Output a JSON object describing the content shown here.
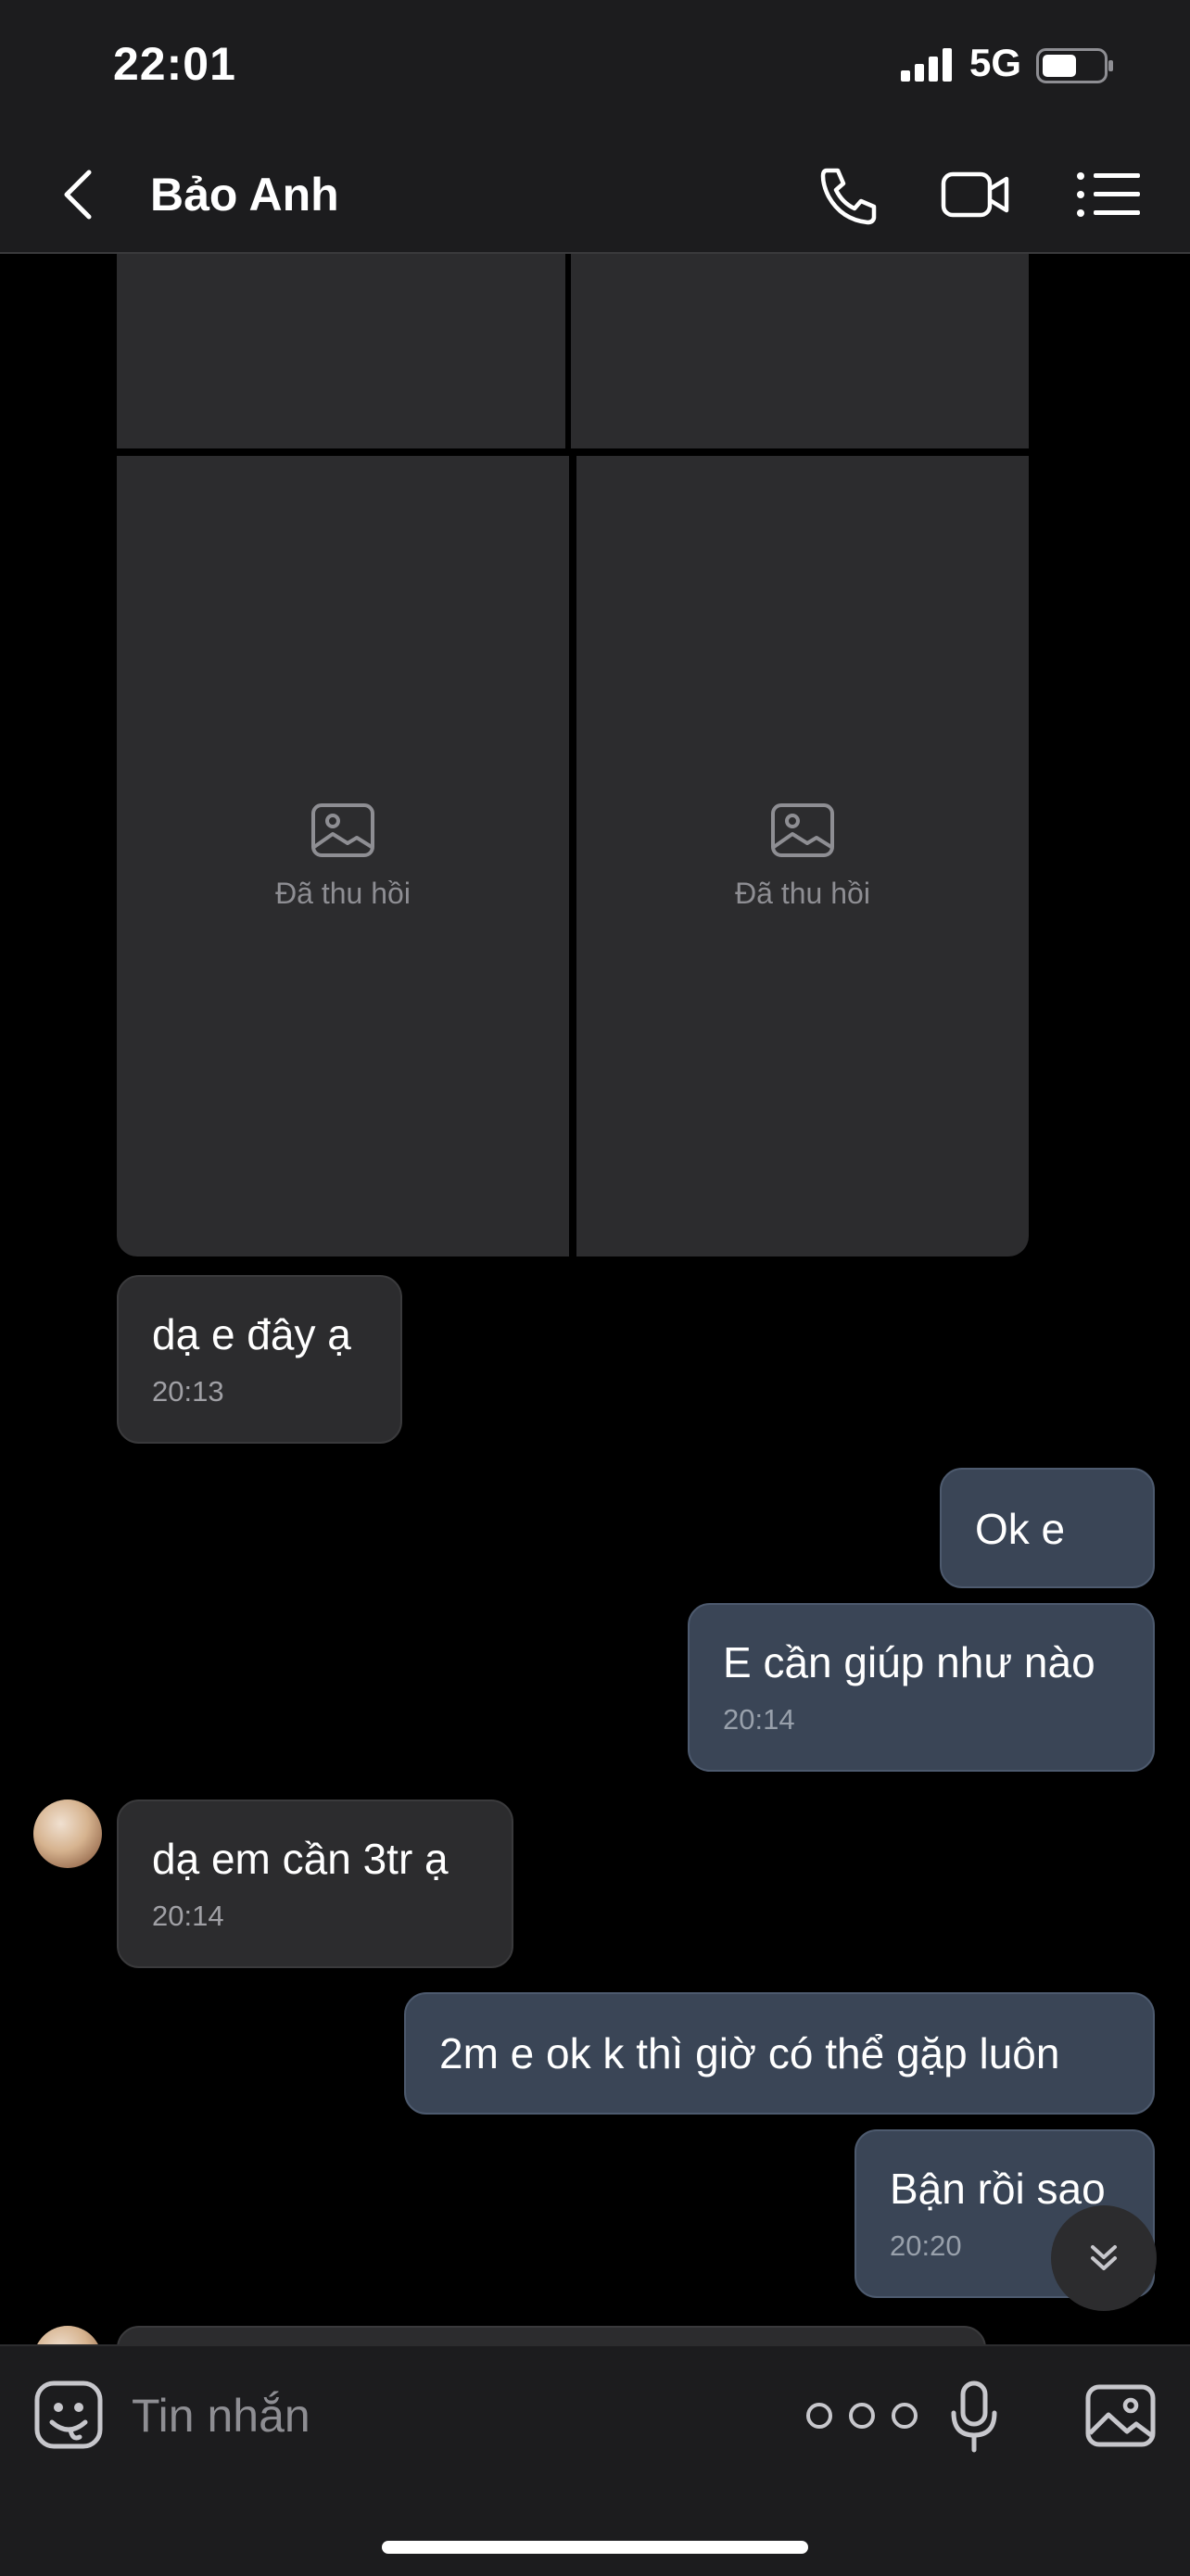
{
  "status_bar": {
    "time": "22:01",
    "network": "5G"
  },
  "header": {
    "contact_name": "Bảo Anh"
  },
  "recalled_label": "Đã thu hồi",
  "messages": [
    {
      "text": "dạ e đây ạ",
      "time": "20:13"
    },
    {
      "text": "Ok e"
    },
    {
      "text": "E cần giúp như nào",
      "time": "20:14"
    },
    {
      "text": "dạ em cần 3tr ạ",
      "time": "20:14"
    },
    {
      "text": "2m e ok k thì giờ có thể gặp luôn"
    },
    {
      "text": "Bận rồi sao",
      "time": "20:20"
    }
  ],
  "composer": {
    "placeholder": "Tin nhắn"
  }
}
